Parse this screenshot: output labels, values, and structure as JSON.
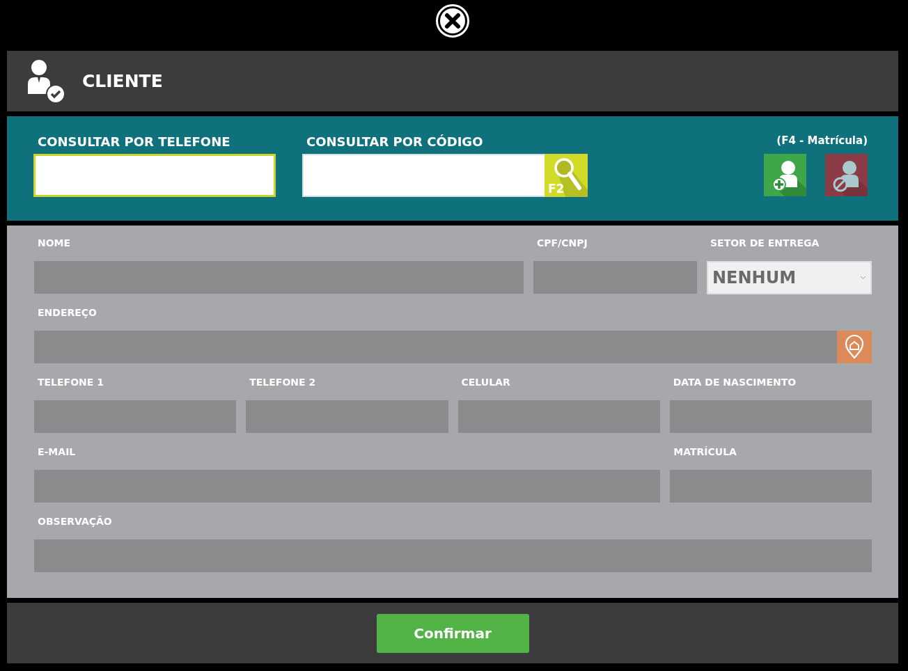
{
  "window": {
    "title": "CLIENTE"
  },
  "search": {
    "fields": [
      {
        "label": "CONSULTAR POR TELEFONE",
        "kind": "plain",
        "focused": true
      },
      {
        "label": "CONSULTAR POR CÓDIGO",
        "kind": "with_button",
        "focused": false,
        "button_label": "F2"
      }
    ],
    "shortcut_hint": "(F4 - Matrícula)"
  },
  "form": {
    "fields": [
      {
        "label": "NOME",
        "kind": "text"
      },
      {
        "label": "CPF/CNPJ",
        "kind": "text"
      },
      {
        "label": "SETOR DE ENTREGA",
        "kind": "select",
        "value": "NENHUM"
      },
      {
        "label": "ENDEREÇO",
        "kind": "address"
      },
      {
        "label": "TELEFONE 1",
        "kind": "text"
      },
      {
        "label": "TELEFONE 2",
        "kind": "text"
      },
      {
        "label": "CELULAR",
        "kind": "text"
      },
      {
        "label": "DATA DE NASCIMENTO",
        "kind": "text"
      },
      {
        "label": "E-MAIL",
        "kind": "text"
      },
      {
        "label": "MATRÍCULA",
        "kind": "text"
      },
      {
        "label": "OBSERVAÇÃO",
        "kind": "text"
      }
    ]
  },
  "footer": {
    "button": "Confirmar"
  }
}
